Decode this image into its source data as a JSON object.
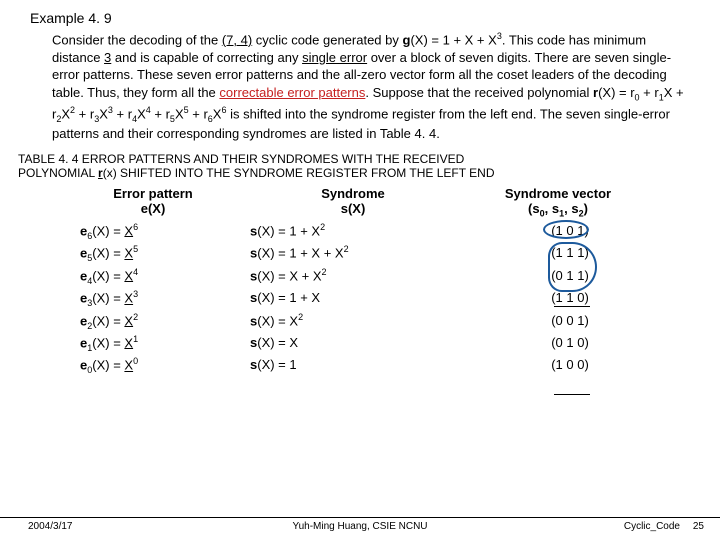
{
  "title": "Example 4. 9",
  "intro": {
    "p1a": "Consider the decoding of the ",
    "code": "(7, 4)",
    "p1b": " cyclic code generated by ",
    "gx": "g",
    "gx2": "(X) = 1 + X + X",
    "gx3": ". This code has minimum distance ",
    "mindist": "3",
    "p1c": " and is capable of correcting any ",
    "single_err": "single error",
    "p1d": " over a block of seven digits. There are seven single-error patterns. These seven error patterns and the all-zero vector form all the coset leaders of the decoding table. Thus, they form all the ",
    "correctable": "correctable error patterns",
    "p1e": ". Suppose that the received polynomial ",
    "rx": "r",
    "rx2": "(X) = r",
    "r0": "0",
    "plus": " + r",
    "r1": "1",
    "xr1": "X + r",
    "r2": "2",
    "xr2": "X",
    "xr2s": "2",
    "xr2p": " + r",
    "r3": "3",
    "xr3": "X",
    "xr3s": "3",
    "xr3p": " + r",
    "r4": "4",
    "xr4": "X",
    "xr4s": "4",
    "xr4p": " + r",
    "r5": "5",
    "xr5": "X",
    "xr5s": "5",
    "xr5p": " + r",
    "r6": "6",
    "xr6": "X",
    "xr6s": "6",
    "p1f": " is shifted into the syndrome register from the left end. The seven single-error patterns and their corresponding syndromes are listed in Table 4. 4."
  },
  "table_caption1": "TABLE 4. 4 ERROR PATTERNS AND THEIR SYNDROMES WITH THE RECEIVED",
  "table_caption2": "POLYNOMIAL ",
  "table_caption_rx": "r",
  "table_caption2b": "(x) SHIFTED INTO THE SYNDROME REGISTER FROM THE LEFT END",
  "hdr": {
    "e1": "Error pattern",
    "e2": "e(X)",
    "s1": "Syndrome",
    "s2": "s(X)",
    "v1": "Syndrome vector",
    "v2a": "(s",
    "v2b": ", s",
    "v2c": ", s",
    "v2d": ")"
  },
  "rows": [
    {
      "ei": "6",
      "e": "X",
      "es": "6",
      "s": "1 + X",
      "ss": "2",
      "v": "(1 0 1)"
    },
    {
      "ei": "5",
      "e": "X",
      "es": "5",
      "s": "1 + X + X",
      "ss": "2",
      "v": "(1 1 1)"
    },
    {
      "ei": "4",
      "e": "X",
      "es": "4",
      "s": "X + X",
      "ss": "2",
      "v": "(0 1 1)"
    },
    {
      "ei": "3",
      "e": "X",
      "es": "3",
      "s": "1 + X",
      "ss": "",
      "v": "(1 1 0)"
    },
    {
      "ei": "2",
      "e": "X",
      "es": "2",
      "s": "X",
      "ss": "2",
      "sOnly": true,
      "v": "(0 0 1)"
    },
    {
      "ei": "1",
      "e": "X",
      "es": "1",
      "s": "X",
      "ss": "",
      "v": "(0 1 0)"
    },
    {
      "ei": "0",
      "e": "X",
      "es": "0",
      "s": "1",
      "ss": "",
      "v": "(1 0 0)"
    }
  ],
  "footer": {
    "date": "2004/3/17",
    "center": "Yuh-Ming Huang, CSIE NCNU",
    "right": "Cyclic_Code",
    "page": "25"
  }
}
